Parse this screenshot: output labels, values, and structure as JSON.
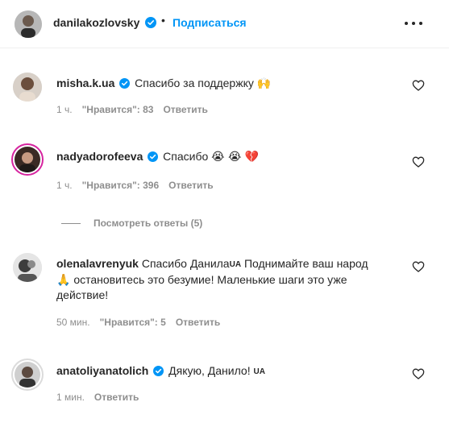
{
  "header": {
    "username": "danilakozlovsky",
    "separator": "•",
    "follow_label": "Подписаться"
  },
  "comments": [
    {
      "username": "misha.k.ua",
      "text": "Спасибо за поддержку",
      "emoji": "🙌",
      "time": "1 ч.",
      "likes": "\"Нравится\": 83",
      "reply": "Ответить"
    },
    {
      "username": "nadyadorofeeva",
      "text": "Спасибо",
      "emoji": "😭 😭 💔",
      "time": "1 ч.",
      "likes": "\"Нравится\": 396",
      "reply": "Ответить"
    },
    {
      "username": "olenalavrenyuk",
      "text_part1": "Спасибо Данила",
      "flag": "UA",
      "text_part2": " Поднимайте ваш народ",
      "emoji": "🙏",
      "text_part3": " остановитесь это безумие! Маленькие шаги это уже действие!",
      "time": "50 мин.",
      "likes": "\"Нравится\": 5",
      "reply": "Ответить"
    },
    {
      "username": "anatoliyanatolich",
      "text": "Дякую, Данило!",
      "flag": "UA",
      "time": "1 мин.",
      "reply": "Ответить"
    }
  ],
  "view_replies": "Посмотреть ответы (5)",
  "colors": {
    "accent": "#0095f6",
    "verified": "#0095f6",
    "muted": "#8e8e8e",
    "text": "#262626"
  },
  "icons": {
    "verified": "verified-badge-icon",
    "heart": "heart-outline-icon",
    "more": "more-horizontal-icon"
  }
}
